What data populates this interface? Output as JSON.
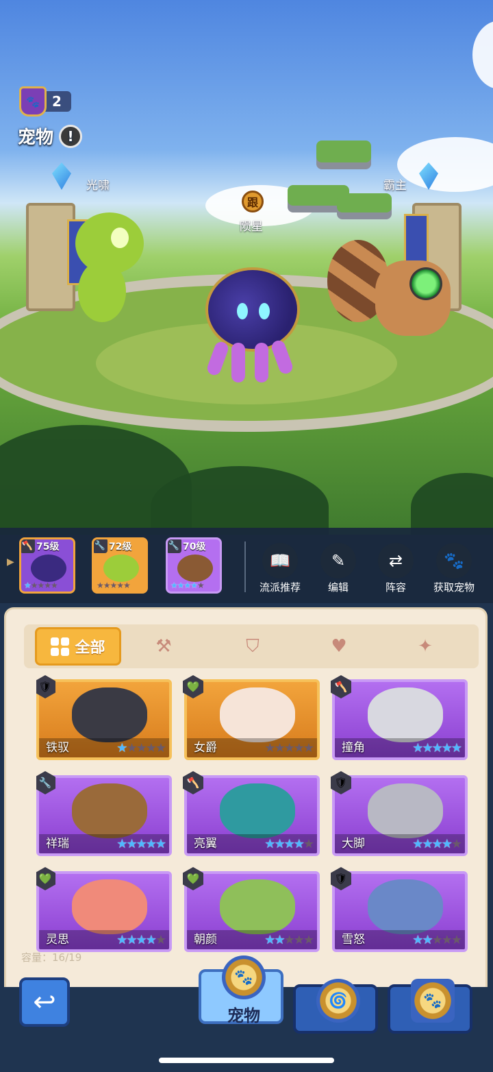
{
  "header": {
    "rank_count": "2",
    "title": "宠物",
    "info_icon": "!"
  },
  "arena": {
    "left_slot_label": "光啸",
    "right_slot_label": "霸主",
    "follow_tag": "跟",
    "center_pet_name": "陨星"
  },
  "team": [
    {
      "level": "75级",
      "type_icon": "axe-icon",
      "stars": 1,
      "max_stars": 5,
      "color": "#b46ff0"
    },
    {
      "level": "72级",
      "type_icon": "wrench-icon",
      "stars": 0,
      "max_stars": 5,
      "color": "#f2a43c"
    },
    {
      "level": "70级",
      "type_icon": "wrench-icon",
      "stars": 4,
      "max_stars": 5,
      "color": "#b46ff0"
    }
  ],
  "actions": [
    {
      "label": "流派推荐",
      "icon": "book-icon"
    },
    {
      "label": "编辑",
      "icon": "pencil-icon"
    },
    {
      "label": "阵容",
      "icon": "swap-icon"
    },
    {
      "label": "获取宠物",
      "icon": "paw-icon"
    }
  ],
  "filters": {
    "all_label": "全部",
    "tabs": [
      "axe-icon",
      "shield-icon",
      "heart-icon",
      "wrench-icon"
    ]
  },
  "pets": [
    {
      "name": "铁驭",
      "rarity": "orange",
      "type_icon": "shield-icon",
      "stars": 1
    },
    {
      "name": "女爵",
      "rarity": "orange",
      "type_icon": "heart-icon",
      "stars": 0
    },
    {
      "name": "撞角",
      "rarity": "purple",
      "type_icon": "axe-icon",
      "stars": 5
    },
    {
      "name": "祥瑞",
      "rarity": "purple",
      "type_icon": "wrench-icon",
      "stars": 5
    },
    {
      "name": "亮翼",
      "rarity": "purple",
      "type_icon": "axe-icon",
      "stars": 4
    },
    {
      "name": "大脚",
      "rarity": "purple",
      "type_icon": "shield-icon",
      "stars": 4
    },
    {
      "name": "灵思",
      "rarity": "purple",
      "type_icon": "heart-icon",
      "stars": 4
    },
    {
      "name": "朝颜",
      "rarity": "purple",
      "type_icon": "heart-icon",
      "stars": 2
    },
    {
      "name": "雪怒",
      "rarity": "purple",
      "type_icon": "shield-icon",
      "stars": 2
    }
  ],
  "capacity": {
    "label": "容量：",
    "value": "16/19"
  },
  "bottom_nav": {
    "active_label": "宠物"
  },
  "colors": {
    "accent_orange": "#f7b73e",
    "rare_purple": "#b36ff0",
    "epic_orange": "#f2a43c",
    "star_blue": "#4fb8ff"
  }
}
